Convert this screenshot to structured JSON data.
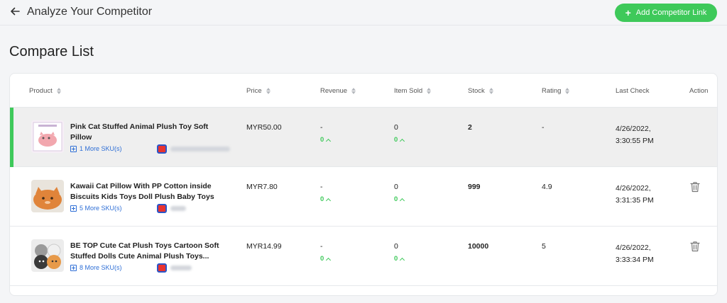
{
  "header": {
    "title": "Analyze Your Competitor",
    "add_button_label": "Add Competitor Link"
  },
  "section_title": "Compare List",
  "columns": [
    "Product",
    "Price",
    "Revenue",
    "Item Sold",
    "Stock",
    "Rating",
    "Last Check",
    "Action"
  ],
  "rows": [
    {
      "name": "Pink Cat Stuffed Animal Plush Toy Soft Pillow",
      "sku": "1 More SKU(s)",
      "price": "MYR50.00",
      "revenue": "-",
      "revenue_change": "0",
      "item_sold": "0",
      "item_sold_change": "0",
      "stock": "2",
      "rating": "-",
      "last_check_date": "4/26/2022,",
      "last_check_time": "3:30:55 PM"
    },
    {
      "name": "Kawaii Cat Pillow With PP Cotton inside Biscuits Kids Toys Doll Plush Baby Toys Bi...",
      "sku": "5 More SKU(s)",
      "price": "MYR7.80",
      "revenue": "-",
      "revenue_change": "0",
      "item_sold": "0",
      "item_sold_change": "0",
      "stock": "999",
      "rating": "4.9",
      "last_check_date": "4/26/2022,",
      "last_check_time": "3:31:35 PM"
    },
    {
      "name": "BE TOP Cute Cat Plush Toys Cartoon Soft Stuffed Dolls Cute Animal Plush Toys...",
      "sku": "8 More SKU(s)",
      "price": "MYR14.99",
      "revenue": "-",
      "revenue_change": "0",
      "item_sold": "0",
      "item_sold_change": "0",
      "stock": "10000",
      "rating": "5",
      "last_check_date": "4/26/2022,",
      "last_check_time": "3:33:34 PM"
    }
  ],
  "colors": {
    "accent_green": "#3ec95a",
    "link_blue": "#2f6fd6",
    "selected_row": "#efefef"
  },
  "icons": {
    "back": "arrow-left-icon",
    "add": "plus-icon",
    "sort": "sort-icon",
    "sku": "plus-square-icon",
    "shop": "shop-icon",
    "delete": "trash-icon"
  }
}
